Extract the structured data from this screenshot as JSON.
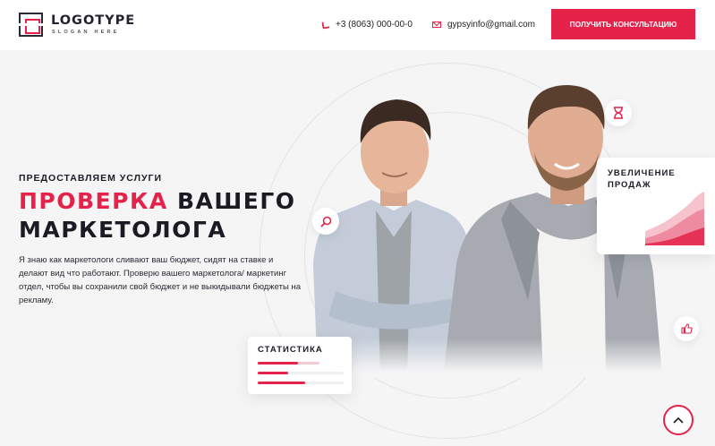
{
  "header": {
    "logo_name": "LOGOTYPE",
    "logo_slogan": "SLOGAN HERE",
    "phone": "+3 (8063) 000-00-0",
    "email": "gypsyinfo@gmail.com",
    "cta_label": "ПОЛУЧИТЬ КОНСУЛЬТАЦИЮ"
  },
  "hero": {
    "eyebrow": "ПРЕДОСТАВЛЯЕМ УСЛУГИ",
    "title_accent": "ПРОВЕРКА",
    "title_rest_1": " ВАШЕГО",
    "title_rest_2": "МАРКЕТОЛОГА",
    "description": "Я знаю как маркетологи сливают ваш бюджет, сидят на ставке и делают вид что работают. Проверю вашего маркетолога/ маркетинг отдел, чтобы вы сохранили свой бюджет и не выкидывали бюджеты на рекламу."
  },
  "cards": {
    "sales_title": "УВЕЛИЧЕНИЕ ПРОДАЖ",
    "stats_title": "СТАТИСТИКА",
    "stats_bars": [
      0.65,
      0.35,
      0.55
    ]
  },
  "icons": {
    "hourglass": "hourglass-icon",
    "search": "search-icon",
    "like": "thumbs-up-icon",
    "scroll_top": "chevron-up-icon",
    "phone": "phone-icon",
    "email": "mail-icon"
  },
  "colors": {
    "accent": "#e5224a",
    "text": "#1b1b24",
    "background": "#f5f5f6"
  }
}
